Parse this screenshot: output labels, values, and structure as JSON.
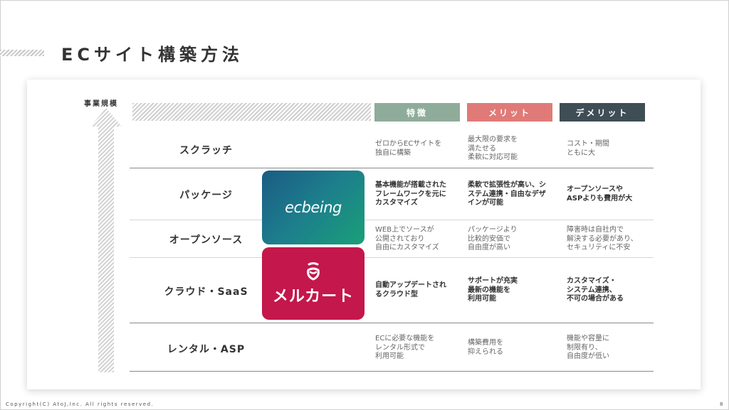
{
  "title": "ECサイト構築方法",
  "axis_label": "事業規模",
  "columns": [
    {
      "label": "特徴",
      "color": "#8fac9b"
    },
    {
      "label": "メリット",
      "color": "#e07a78"
    },
    {
      "label": "デメリット",
      "color": "#3f4d55"
    }
  ],
  "rows": [
    {
      "method": "スクラッチ",
      "feature": "ゼロからECサイトを\n独自に構築",
      "merit": "最大限の要求を\n満たせる\n柔軟に対応可能",
      "demerit": "コスト・期間\nともに大"
    },
    {
      "method": "パッケージ",
      "feature": "基本機能が搭載された\nフレームワークを元に\nカスタマイズ",
      "merit": "柔軟で拡張性が高い、シ\nステム連携・自由なデザ\nインが可能",
      "demerit": "オープンソースや\nASPよりも費用が大"
    },
    {
      "method": "オープンソース",
      "feature": "WEB上でソースが\n公開されており\n自由にカスタマイズ",
      "merit": "パッケージより\n比較的安価で\n自由度が高い",
      "demerit": "障害時は自社内で\n解決する必要があり、\nセキュリティに不安"
    },
    {
      "method": "クラウド・SaaS",
      "feature": "自動アップデートされ\nるクラウド型",
      "merit": "サポートが充実\n最新の機能を\n利用可能",
      "demerit": "カスタマイズ・\nシステム連携、\n不可の場合がある"
    },
    {
      "method": "レンタル・ASP",
      "feature": "ECに必要な機能を\nレンタル形式で\n利用可能",
      "merit": "構築費用を\n抑えられる",
      "demerit": "機能や容量に\n制限有り、\n自由度が低い"
    }
  ],
  "logos": {
    "ecbeing": "ecbeing",
    "makeshop": "メルカート"
  },
  "footer": "Copyright(C) AtoJ,Inc. All rights reserved.",
  "page_number": "8"
}
